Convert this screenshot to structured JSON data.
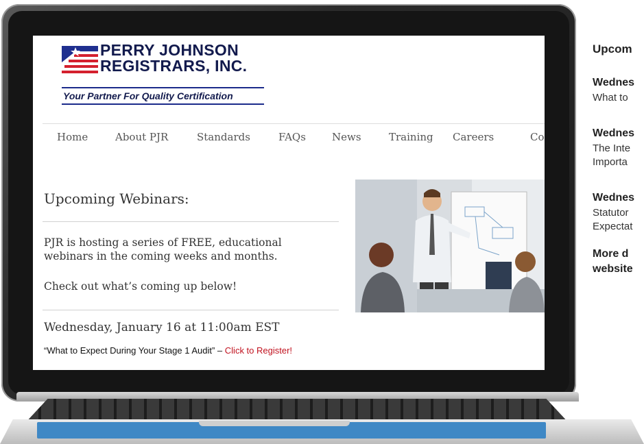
{
  "site": {
    "logo": {
      "name_line1": "PERRY JOHNSON",
      "name_line2": "REGISTRARS, INC.",
      "tagline": "Your Partner For Quality Certification"
    },
    "nav": [
      "Home",
      "About PJR",
      "Standards",
      "FAQs",
      "News",
      "Training",
      "Careers",
      "Co"
    ],
    "content": {
      "heading": "Upcoming Webinars:",
      "intro_line1": "PJR is hosting a series of FREE, educational",
      "intro_line2": "webinars in the coming weeks and months.",
      "cta": "Check out what’s coming up below!",
      "event_date": "Wednesday, January 16 at 11:00am EST",
      "event_title": "“What to Expect During Your Stage 1 Audit” –",
      "register_link": "Click to Register!"
    }
  },
  "side_panel": {
    "title": "Upcom",
    "item1_bold": "Wednes",
    "item1_text": "What to",
    "item2_bold": "Wednes",
    "item2_text1": "The Inte",
    "item2_text2": "Importa",
    "item3_bold": "Wednes",
    "item3_text1": "Statutor",
    "item3_text2": "Expectat",
    "more1": "More d",
    "more2": "website"
  },
  "colors": {
    "logo_navy": "#121a4d",
    "register_red": "#c1121f",
    "touch_strip_blue": "#3f88c5"
  }
}
